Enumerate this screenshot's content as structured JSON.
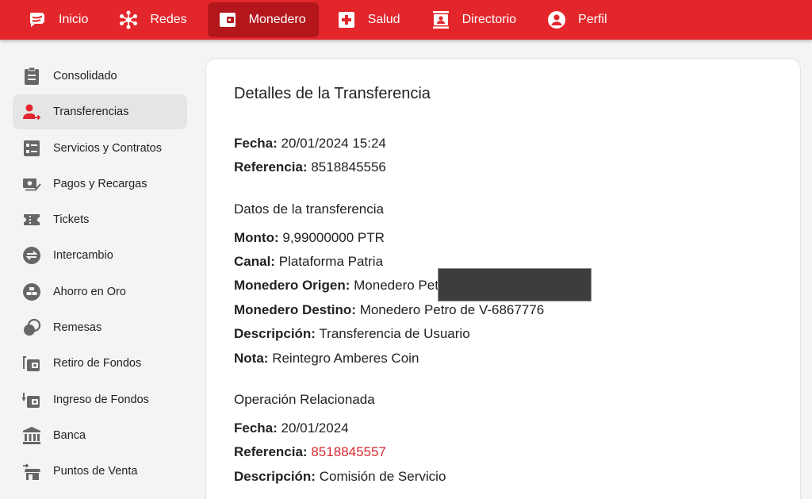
{
  "topnav": {
    "items": [
      {
        "label": "Inicio",
        "icon": "chat-star-icon"
      },
      {
        "label": "Redes",
        "icon": "network-icon"
      },
      {
        "label": "Monedero",
        "icon": "wallet-icon",
        "active": true
      },
      {
        "label": "Salud",
        "icon": "medical-cross-icon"
      },
      {
        "label": "Directorio",
        "icon": "contact-card-icon"
      },
      {
        "label": "Perfil",
        "icon": "user-circle-icon"
      }
    ],
    "bg_color": "#e3262b",
    "active_color": "#b3171c"
  },
  "sidebar": {
    "items": [
      {
        "label": "Consolidado",
        "icon": "clipboard-icon"
      },
      {
        "label": "Transferencias",
        "icon": "user-transfer-icon",
        "active": true
      },
      {
        "label": "Servicios y Contratos",
        "icon": "checklist-icon"
      },
      {
        "label": "Pagos y Recargas",
        "icon": "payment-icon"
      },
      {
        "label": "Tickets",
        "icon": "ticket-icon"
      },
      {
        "label": "Intercambio",
        "icon": "exchange-icon"
      },
      {
        "label": "Ahorro en Oro",
        "icon": "gold-bars-icon"
      },
      {
        "label": "Remesas",
        "icon": "coins-icon"
      },
      {
        "label": "Retiro de Fondos",
        "icon": "withdraw-icon"
      },
      {
        "label": "Ingreso de Fondos",
        "icon": "deposit-icon"
      },
      {
        "label": "Banca",
        "icon": "bank-icon"
      },
      {
        "label": "Puntos de Venta",
        "icon": "store-icon"
      }
    ]
  },
  "details": {
    "title": "Detalles de la Transferencia",
    "fecha_label": "Fecha:",
    "fecha_value": "20/01/2024 15:24",
    "referencia_label": "Referencia:",
    "referencia_value": "8518845556",
    "section_transfer": "Datos de la transferencia",
    "monto_label": "Monto:",
    "monto_value": "9,99000000 PTR",
    "canal_label": "Canal:",
    "canal_value": "Plataforma Patria",
    "origen_label": "Monedero Origen:",
    "origen_value": "Monedero Petro",
    "destino_label": "Monedero Destino:",
    "destino_value": "Monedero Petro de V-6867776",
    "descripcion_label": "Descripción:",
    "descripcion_value": "Transferencia de Usuario",
    "nota_label": "Nota:",
    "nota_value": "Reintegro Amberes Coin",
    "section_related": "Operación Relacionada",
    "rel_fecha_label": "Fecha:",
    "rel_fecha_value": "20/01/2024",
    "rel_referencia_label": "Referencia:",
    "rel_referencia_value": "8518845557",
    "rel_descripcion_label": "Descripción:",
    "rel_descripcion_value": "Comisión de Servicio",
    "link_color": "#d9292f"
  }
}
